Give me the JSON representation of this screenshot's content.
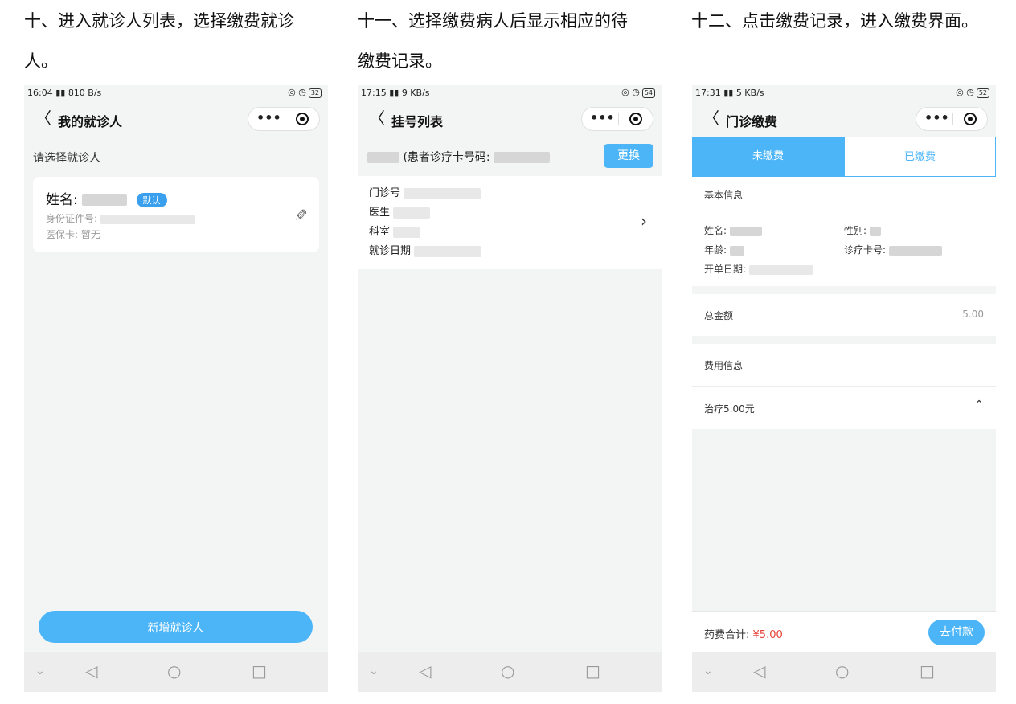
{
  "captions": {
    "step10_line1": "十、进入就诊人列表，选择缴费就诊",
    "step10_line2": "人。",
    "step11_line1": "十一、选择缴费病人后显示相应的待",
    "step11_line2": "缴费记录。",
    "step12_line1": "十二、点击缴费记录，进入缴费界面。"
  },
  "phone1": {
    "status_time": "16:04",
    "status_speed": "810 B/s",
    "battery": "32",
    "nav_title": "我的就诊人",
    "select_label": "请选择就诊人",
    "name_label": "姓名:",
    "default_badge": "默认",
    "id_label": "身份证件号:",
    "insurance_label": "医保卡: 暂无",
    "add_button": "新增就诊人"
  },
  "phone2": {
    "status_time": "17:15",
    "status_speed": "9 KB/s",
    "battery": "54",
    "nav_title": "挂号列表",
    "patient_card_label": "(患者诊疗卡号码:",
    "change_button": "更换",
    "rows": [
      "门诊号",
      "医生",
      "科室",
      "就诊日期"
    ]
  },
  "phone3": {
    "status_time": "17:31",
    "status_speed": "5 KB/s",
    "battery": "52",
    "nav_title": "门诊缴费",
    "tab_unpaid": "未缴费",
    "tab_paid": "已缴费",
    "basic_info": "基本信息",
    "name_label": "姓名:",
    "gender_label": "性别:",
    "age_label": "年龄:",
    "card_label": "诊疗卡号:",
    "date_label": "开单日期:",
    "total_label": "总金额",
    "total_value": "5.00",
    "fee_info": "费用信息",
    "fee_item": "治疗5.00元",
    "footer_label": "药费合计:",
    "footer_amount": "¥5.00",
    "pay_button": "去付款"
  },
  "icons": {
    "back": "back-arrow-icon",
    "more": "more-dots-icon",
    "close_target": "target-icon",
    "edit": "pencil-icon",
    "chevron_right": "chevron-right-icon",
    "chevron_up": "chevron-up-icon"
  },
  "colors": {
    "accent": "#4bb5f8",
    "price_red": "#e8413a",
    "background": "#f3f4f4"
  }
}
